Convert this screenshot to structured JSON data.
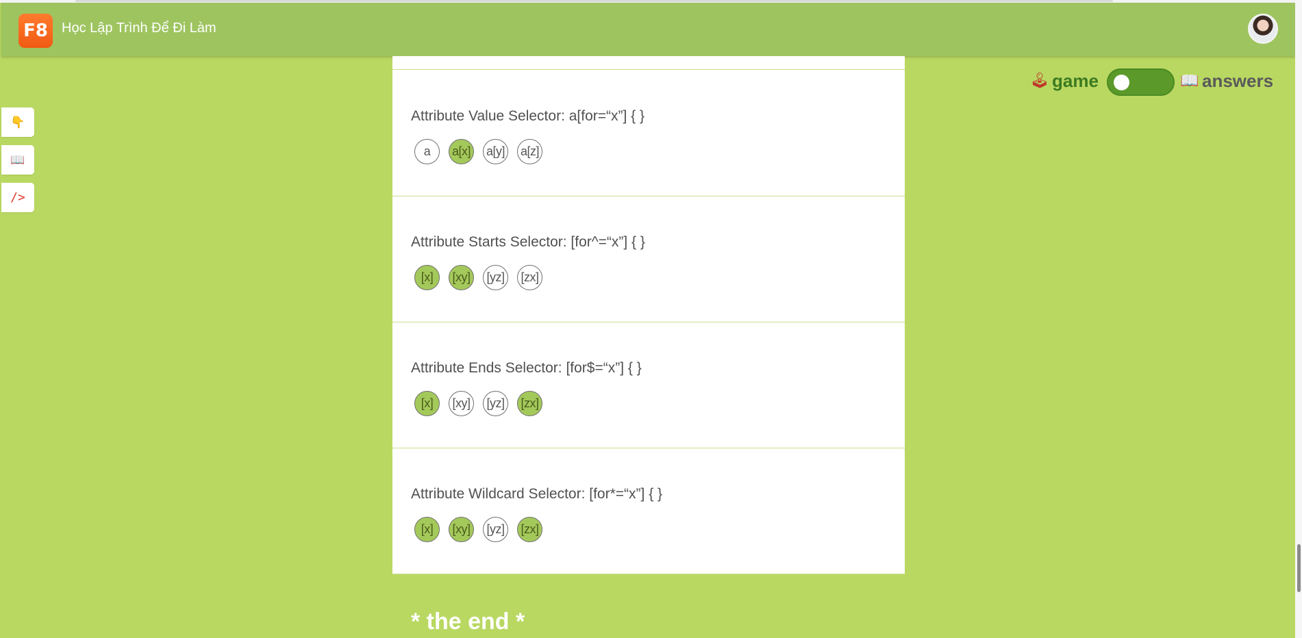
{
  "header": {
    "logo_text": "F8",
    "site_title": "Học Lập Trình Để Đi Làm",
    "brand_color": "#9ec460",
    "logo_color": "#f05a12"
  },
  "side_tools": [
    {
      "name": "hand-pointer-icon",
      "glyph": "👇"
    },
    {
      "name": "book-icon",
      "glyph": "📖"
    },
    {
      "name": "code-icon",
      "glyph": "/>"
    }
  ],
  "mode_toggle": {
    "game_icon": "🕹",
    "game_label": "game",
    "answers_icon": "📖",
    "answers_label": "answers",
    "state": "game"
  },
  "sections": [
    {
      "title": "Attribute Value Selector: a[for=“x”] { }",
      "chips": [
        {
          "label": "a",
          "selected": false
        },
        {
          "label": "a[x]",
          "selected": true
        },
        {
          "label": "a[y]",
          "selected": false
        },
        {
          "label": "a[z]",
          "selected": false
        }
      ]
    },
    {
      "title": "Attribute Starts Selector: [for^=“x”] { }",
      "chips": [
        {
          "label": "[x]",
          "selected": true
        },
        {
          "label": "[xy]",
          "selected": true
        },
        {
          "label": "[yz]",
          "selected": false
        },
        {
          "label": "[zx]",
          "selected": false
        }
      ]
    },
    {
      "title": "Attribute Ends Selector: [for$=“x”] { }",
      "chips": [
        {
          "label": "[x]",
          "selected": true
        },
        {
          "label": "[xy]",
          "selected": false
        },
        {
          "label": "[yz]",
          "selected": false
        },
        {
          "label": "[zx]",
          "selected": true
        }
      ]
    },
    {
      "title": "Attribute Wildcard Selector: [for*=“x”] { }",
      "chips": [
        {
          "label": "[x]",
          "selected": true
        },
        {
          "label": "[xy]",
          "selected": true
        },
        {
          "label": "[yz]",
          "selected": false
        },
        {
          "label": "[zx]",
          "selected": true
        }
      ]
    }
  ],
  "footer_text": "* the end *",
  "colors": {
    "background": "#b9d862",
    "selected_chip": "#a4c95b",
    "toggle": "#5b9a2a"
  }
}
